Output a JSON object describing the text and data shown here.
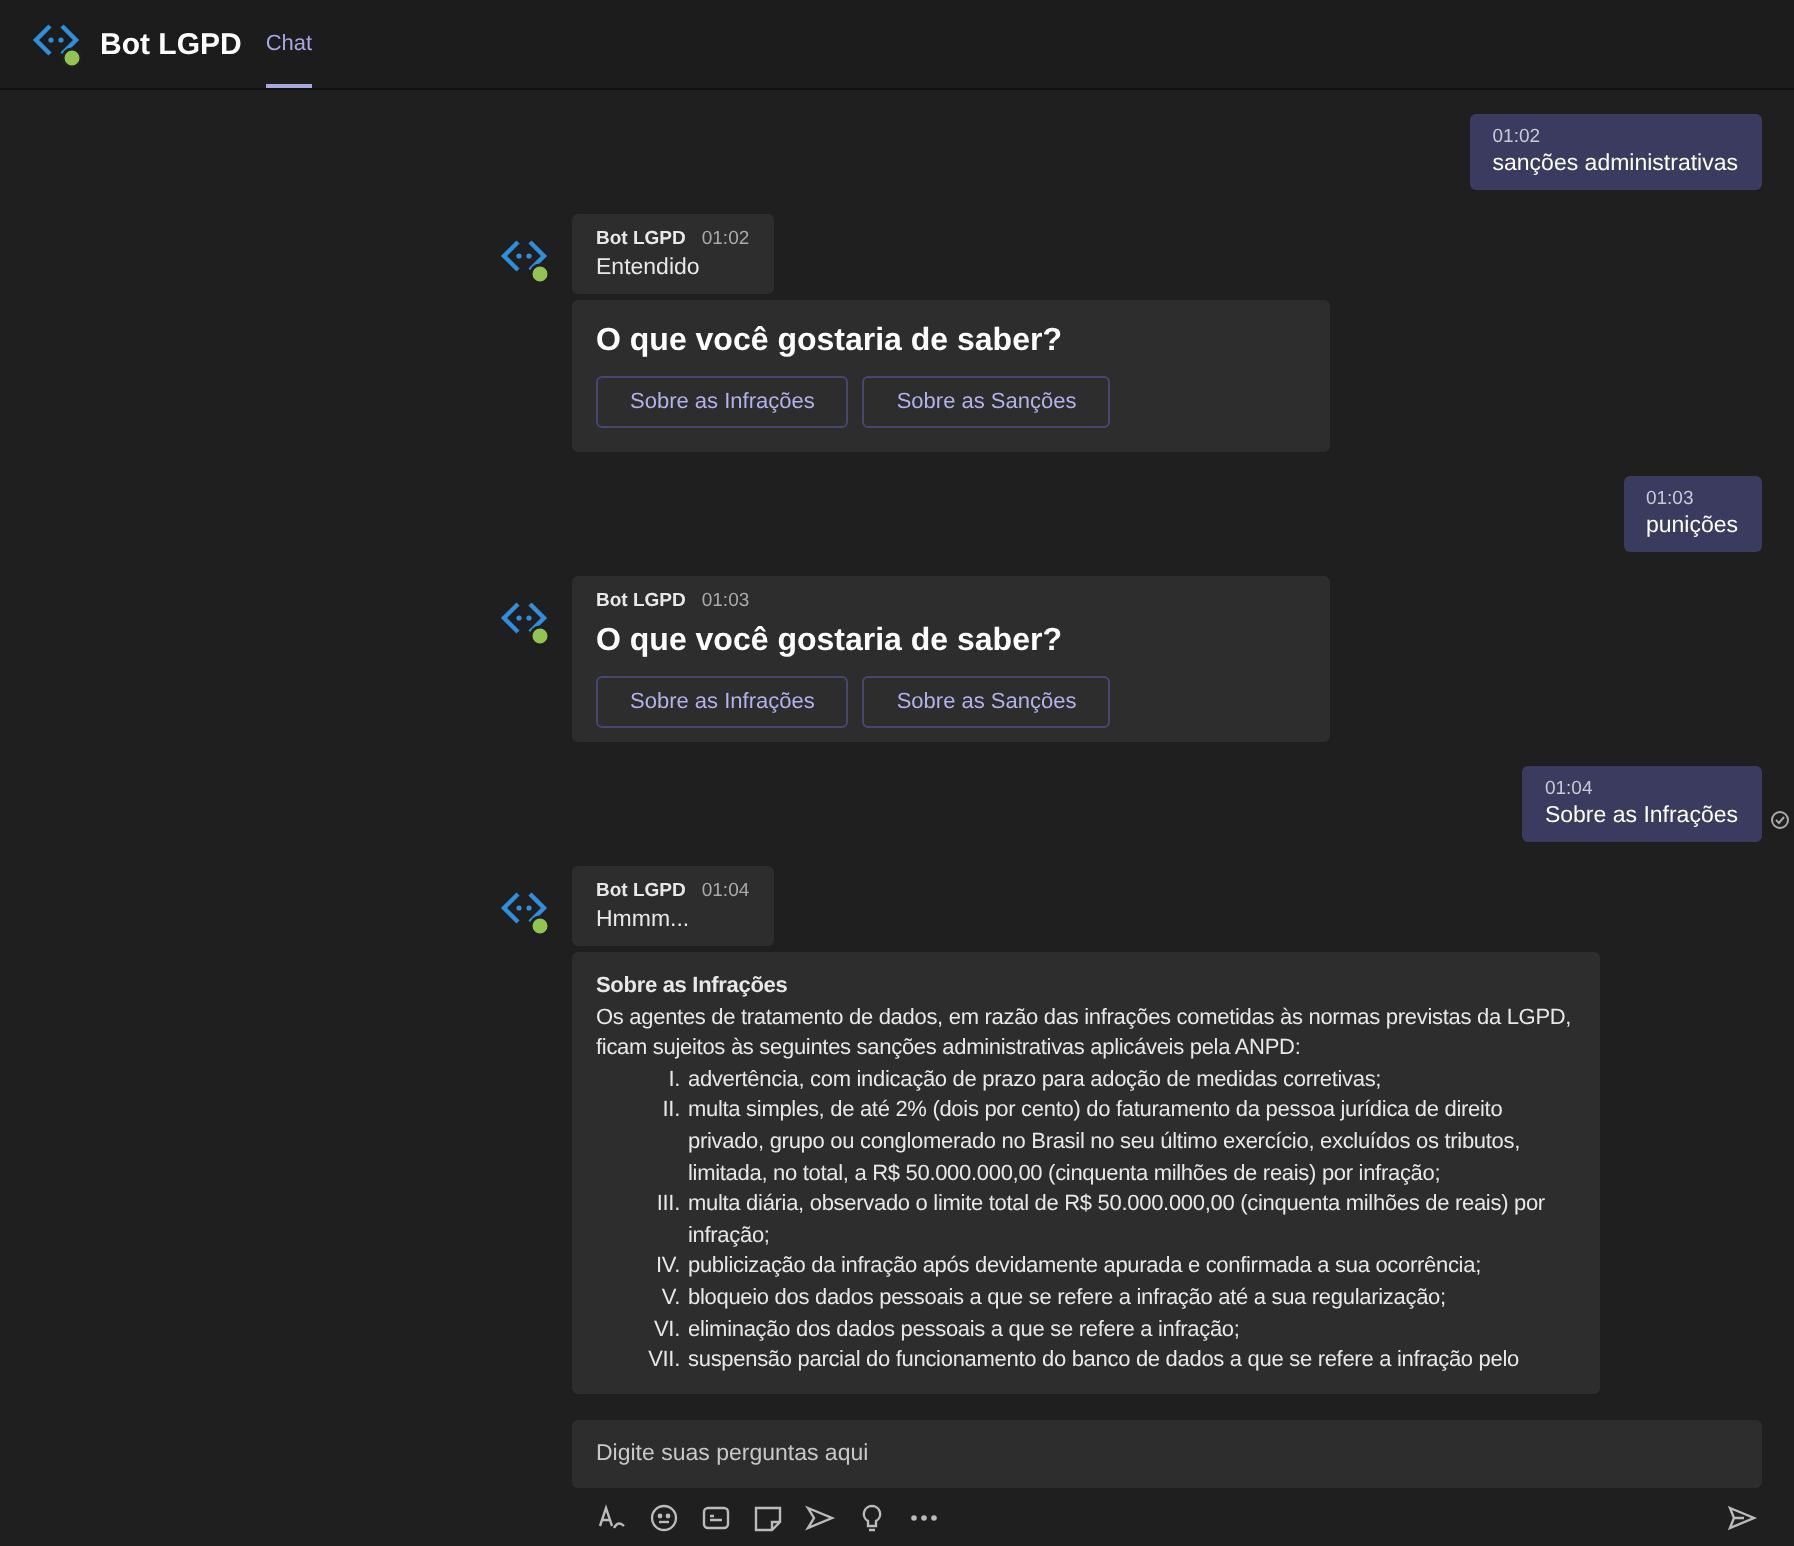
{
  "header": {
    "title": "Bot LGPD",
    "tabs": [
      {
        "label": "Chat",
        "selected": true
      }
    ]
  },
  "messages": [
    {
      "kind": "sent",
      "time": "01:02",
      "text": "sanções administrativas",
      "read": false
    },
    {
      "kind": "bot",
      "sender": "Bot LGPD",
      "time": "01:02",
      "content": [
        {
          "kind": "text",
          "text": "Entendido"
        },
        {
          "kind": "choice",
          "title": "O que você gostaria de saber?",
          "buttons": [
            "Sobre as Infrações",
            "Sobre as Sanções"
          ]
        }
      ]
    },
    {
      "kind": "sent",
      "time": "01:03",
      "text": "punições",
      "read": false
    },
    {
      "kind": "bot",
      "sender": "Bot LGPD",
      "time": "01:03",
      "content": [
        {
          "kind": "choice",
          "title": "O que você gostaria de saber?",
          "buttons": [
            "Sobre as Infrações",
            "Sobre as Sanções"
          ]
        }
      ]
    },
    {
      "kind": "sent",
      "time": "01:04",
      "text": "Sobre as Infrações",
      "read": true
    },
    {
      "kind": "bot",
      "sender": "Bot LGPD",
      "time": "01:04",
      "content": [
        {
          "kind": "text",
          "text": "Hmmm..."
        },
        {
          "kind": "article",
          "title": "Sobre as Infrações",
          "intro": "Os agentes de tratamento de dados, em razão das infrações cometidas às normas previstas da LGPD, ficam sujeitos às seguintes sanções administrativas aplicáveis pela ANPD:",
          "items": [
            {
              "marker": "I.",
              "text": "advertência, com indicação de prazo para adoção de medidas corretivas;"
            },
            {
              "marker": "II.",
              "text": "multa simples, de até 2% (dois por cento) do faturamento da pessoa jurídica de direito privado, grupo ou conglomerado no Brasil no seu último exercício, excluídos os tributos, limitada, no total, a R$ 50.000.000,00 (cinquenta milhões de reais) por infração;"
            },
            {
              "marker": "III.",
              "text": "multa diária, observado o limite total de R$ 50.000.000,00 (cinquenta milhões de reais) por infração;"
            },
            {
              "marker": "IV.",
              "text": "publicização da infração após devidamente apurada e confirmada a sua ocorrência;"
            },
            {
              "marker": "V.",
              "text": "bloqueio dos dados pessoais a que se refere a infração até a sua regularização;"
            },
            {
              "marker": "VI.",
              "text": "eliminação dos dados pessoais a que se refere a infração;"
            },
            {
              "marker": "VII.",
              "text": "suspensão parcial do funcionamento do banco de dados a que se refere a infração pelo"
            }
          ]
        }
      ]
    }
  ],
  "compose": {
    "placeholder": "Digite suas perguntas aqui"
  }
}
